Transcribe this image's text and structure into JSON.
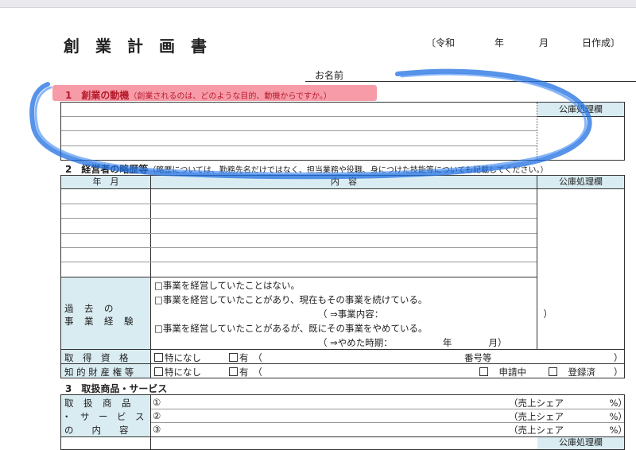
{
  "title": "創業計画書",
  "date": {
    "open": "〔令和",
    "year": "年",
    "month": "月",
    "close": "日作成〕"
  },
  "name_label": "お名前",
  "section1": {
    "title": "1　創業の動機",
    "note": "（創業されるのは、どのような目的、動機からですか。）",
    "office": "公庫処理欄"
  },
  "section2": {
    "title": "2　経営者の略歴等",
    "note": "（略歴については、勤務先名だけではなく、担当業務や役職、身につけた技能等についても記載してください。）",
    "col_date": "年　月",
    "col_content": "内　容",
    "office": "公庫処理欄",
    "past_label_1": "過　去　の",
    "past_label_2": "事　業　経　験",
    "past_options": [
      "□事業を経営していたことはない。",
      "□事業を経営していたことがあり、現在もその事業を続けている。",
      "（ ⇒事業内容：　　　　　　　　　　　　　　　　　　）",
      "□事業を経営していたことがあるが、既にその事業をやめている。",
      "（ ⇒やめた時期：　　　　　　年　　　　月）"
    ],
    "qual_label": "取　得　資　格",
    "qual_none": "特になし",
    "qual_yes": "有　（",
    "qual_num": "番号等",
    "qual_close": "）",
    "ip_label": "知 的 財 産 権 等",
    "ip_none": "特になし",
    "ip_yes": "有　（",
    "ip_pending": "申請中",
    "ip_registered": "登録済",
    "ip_close": "）"
  },
  "section3": {
    "title": "3　取扱商品・サービス",
    "label_1": "取　扱　商　品",
    "label_2": "・　サ　ー　ビ　ス",
    "label_3": "の　　内　　容",
    "items": [
      "①",
      "②",
      "③"
    ],
    "share": "（売上シェア　　　　　%）",
    "office": "公庫処理欄"
  }
}
